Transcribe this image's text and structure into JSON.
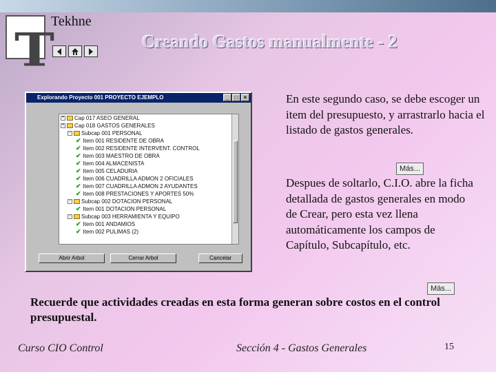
{
  "brand": "Tekhne",
  "slide_title": "Creando Gastos manualmente - 2",
  "nav_icons": [
    "prev-icon",
    "home-icon",
    "next-icon"
  ],
  "window": {
    "title": "Explorando Proyecto 001 PROYECTO EJEMPLO",
    "controls": [
      "_",
      "□",
      "×"
    ],
    "tree": [
      {
        "kind": "cap",
        "label": "Cap 017 ASEO GENERAL"
      },
      {
        "kind": "cap",
        "label": "Cap 018 GASTOS GENERALES"
      },
      {
        "kind": "sub",
        "label": "Subcap 001 PERSONAL"
      },
      {
        "kind": "item",
        "label": "Item 001 RESIDENTE DE OBRA"
      },
      {
        "kind": "item",
        "label": "Item 002 RESIDENTE INTERVENT. CONTROL"
      },
      {
        "kind": "item",
        "label": "Item 003 MAESTRO DE OBRA"
      },
      {
        "kind": "item",
        "label": "Item 004 ALMACENISTA"
      },
      {
        "kind": "item",
        "label": "Item 005 CELADURIA"
      },
      {
        "kind": "item",
        "label": "Item 006 CUADRILLA ADMON 2 OFICIALES"
      },
      {
        "kind": "item",
        "label": "Item 007 CUADRILLA ADMON 2 AYUDANTES"
      },
      {
        "kind": "item",
        "label": "Item 008 PRESTACIONES Y APORTES 50%"
      },
      {
        "kind": "sub",
        "label": "Subcap 002 DOTACION PERSONAL"
      },
      {
        "kind": "item",
        "label": "Item 001 DOTACION PERSONAL"
      },
      {
        "kind": "sub",
        "label": "Subcap 003 HERRAMIENTA Y EQUIPO"
      },
      {
        "kind": "item",
        "label": "Item 001 ANDAMIOS"
      },
      {
        "kind": "item",
        "label": "Item 002 PULIMAS (2)"
      }
    ],
    "buttons": {
      "open_tree": "Abrir Arbol",
      "close_tree": "Cerrar Arbol",
      "cancel": "Cancelar"
    }
  },
  "paragraph1": "En este segundo caso, se debe escoger un item del presupuesto, y arrastrarlo hacia el listado de gastos generales.",
  "mas_label": "Más...",
  "paragraph2": "Despues de soltarlo, C.I.O. abre la ficha detallada de gastos generales en modo de Crear, pero esta vez llena automáticamente los campos de Capítulo, Subcapítulo, etc.",
  "note": "Recuerde que actividades creadas en esta forma generan sobre costos en el control presupuestal.",
  "footer": {
    "left": "Curso CIO Control",
    "center": "Sección 4 - Gastos Generales",
    "page": "15"
  },
  "colors": {
    "window_title_bar": "#0a246a",
    "check": "#1a9a1a"
  }
}
